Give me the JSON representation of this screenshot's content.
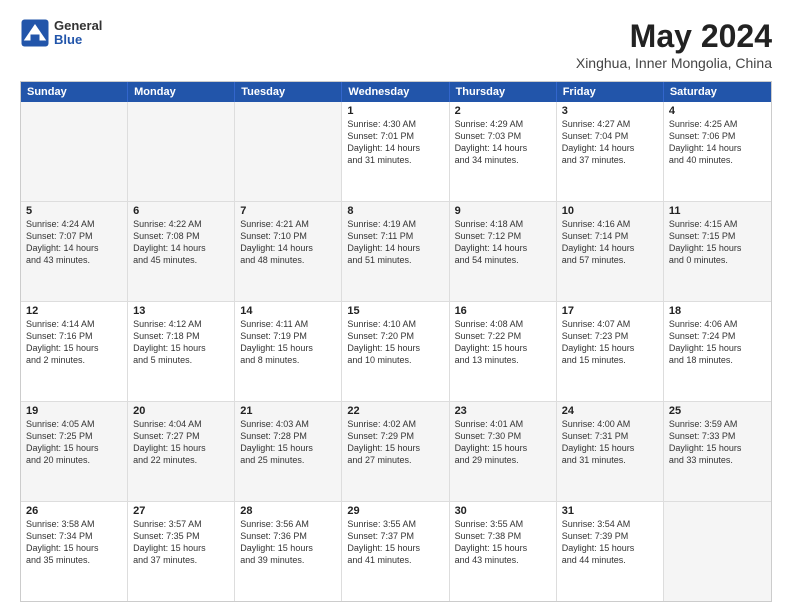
{
  "header": {
    "logo_general": "General",
    "logo_blue": "Blue",
    "title": "May 2024",
    "subtitle": "Xinghua, Inner Mongolia, China"
  },
  "calendar": {
    "days_of_week": [
      "Sunday",
      "Monday",
      "Tuesday",
      "Wednesday",
      "Thursday",
      "Friday",
      "Saturday"
    ],
    "rows": [
      [
        {
          "day": "",
          "text": "",
          "empty": true
        },
        {
          "day": "",
          "text": "",
          "empty": true
        },
        {
          "day": "",
          "text": "",
          "empty": true
        },
        {
          "day": "1",
          "text": "Sunrise: 4:30 AM\nSunset: 7:01 PM\nDaylight: 14 hours\nand 31 minutes."
        },
        {
          "day": "2",
          "text": "Sunrise: 4:29 AM\nSunset: 7:03 PM\nDaylight: 14 hours\nand 34 minutes."
        },
        {
          "day": "3",
          "text": "Sunrise: 4:27 AM\nSunset: 7:04 PM\nDaylight: 14 hours\nand 37 minutes."
        },
        {
          "day": "4",
          "text": "Sunrise: 4:25 AM\nSunset: 7:06 PM\nDaylight: 14 hours\nand 40 minutes."
        }
      ],
      [
        {
          "day": "5",
          "text": "Sunrise: 4:24 AM\nSunset: 7:07 PM\nDaylight: 14 hours\nand 43 minutes."
        },
        {
          "day": "6",
          "text": "Sunrise: 4:22 AM\nSunset: 7:08 PM\nDaylight: 14 hours\nand 45 minutes."
        },
        {
          "day": "7",
          "text": "Sunrise: 4:21 AM\nSunset: 7:10 PM\nDaylight: 14 hours\nand 48 minutes."
        },
        {
          "day": "8",
          "text": "Sunrise: 4:19 AM\nSunset: 7:11 PM\nDaylight: 14 hours\nand 51 minutes."
        },
        {
          "day": "9",
          "text": "Sunrise: 4:18 AM\nSunset: 7:12 PM\nDaylight: 14 hours\nand 54 minutes."
        },
        {
          "day": "10",
          "text": "Sunrise: 4:16 AM\nSunset: 7:14 PM\nDaylight: 14 hours\nand 57 minutes."
        },
        {
          "day": "11",
          "text": "Sunrise: 4:15 AM\nSunset: 7:15 PM\nDaylight: 15 hours\nand 0 minutes."
        }
      ],
      [
        {
          "day": "12",
          "text": "Sunrise: 4:14 AM\nSunset: 7:16 PM\nDaylight: 15 hours\nand 2 minutes."
        },
        {
          "day": "13",
          "text": "Sunrise: 4:12 AM\nSunset: 7:18 PM\nDaylight: 15 hours\nand 5 minutes."
        },
        {
          "day": "14",
          "text": "Sunrise: 4:11 AM\nSunset: 7:19 PM\nDaylight: 15 hours\nand 8 minutes."
        },
        {
          "day": "15",
          "text": "Sunrise: 4:10 AM\nSunset: 7:20 PM\nDaylight: 15 hours\nand 10 minutes."
        },
        {
          "day": "16",
          "text": "Sunrise: 4:08 AM\nSunset: 7:22 PM\nDaylight: 15 hours\nand 13 minutes."
        },
        {
          "day": "17",
          "text": "Sunrise: 4:07 AM\nSunset: 7:23 PM\nDaylight: 15 hours\nand 15 minutes."
        },
        {
          "day": "18",
          "text": "Sunrise: 4:06 AM\nSunset: 7:24 PM\nDaylight: 15 hours\nand 18 minutes."
        }
      ],
      [
        {
          "day": "19",
          "text": "Sunrise: 4:05 AM\nSunset: 7:25 PM\nDaylight: 15 hours\nand 20 minutes."
        },
        {
          "day": "20",
          "text": "Sunrise: 4:04 AM\nSunset: 7:27 PM\nDaylight: 15 hours\nand 22 minutes."
        },
        {
          "day": "21",
          "text": "Sunrise: 4:03 AM\nSunset: 7:28 PM\nDaylight: 15 hours\nand 25 minutes."
        },
        {
          "day": "22",
          "text": "Sunrise: 4:02 AM\nSunset: 7:29 PM\nDaylight: 15 hours\nand 27 minutes."
        },
        {
          "day": "23",
          "text": "Sunrise: 4:01 AM\nSunset: 7:30 PM\nDaylight: 15 hours\nand 29 minutes."
        },
        {
          "day": "24",
          "text": "Sunrise: 4:00 AM\nSunset: 7:31 PM\nDaylight: 15 hours\nand 31 minutes."
        },
        {
          "day": "25",
          "text": "Sunrise: 3:59 AM\nSunset: 7:33 PM\nDaylight: 15 hours\nand 33 minutes."
        }
      ],
      [
        {
          "day": "26",
          "text": "Sunrise: 3:58 AM\nSunset: 7:34 PM\nDaylight: 15 hours\nand 35 minutes."
        },
        {
          "day": "27",
          "text": "Sunrise: 3:57 AM\nSunset: 7:35 PM\nDaylight: 15 hours\nand 37 minutes."
        },
        {
          "day": "28",
          "text": "Sunrise: 3:56 AM\nSunset: 7:36 PM\nDaylight: 15 hours\nand 39 minutes."
        },
        {
          "day": "29",
          "text": "Sunrise: 3:55 AM\nSunset: 7:37 PM\nDaylight: 15 hours\nand 41 minutes."
        },
        {
          "day": "30",
          "text": "Sunrise: 3:55 AM\nSunset: 7:38 PM\nDaylight: 15 hours\nand 43 minutes."
        },
        {
          "day": "31",
          "text": "Sunrise: 3:54 AM\nSunset: 7:39 PM\nDaylight: 15 hours\nand 44 minutes."
        },
        {
          "day": "",
          "text": "",
          "empty": true
        }
      ]
    ]
  }
}
